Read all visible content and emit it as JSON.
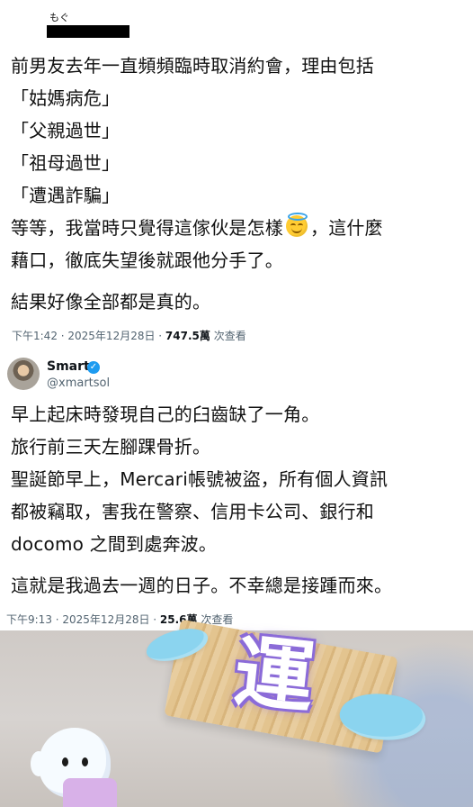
{
  "tweet1": {
    "author_name": "もぐ",
    "lines": [
      "前男友去年一直頻頻臨時取消約會，理由包括",
      "「姑媽病危」",
      "「父親過世」",
      "「祖母過世」",
      "「遭遇詐騙」",
      "等等，我當時只覺得這傢伙是怎樣",
      "，這什麼",
      "藉口，徹底失望後就跟他分手了。",
      "結果好像全部都是真的。"
    ],
    "timestamp": "下午1:42 · 2025年12月28日 · ",
    "views": "747.5萬",
    "views_suffix": " 次查看"
  },
  "tweet2": {
    "display_name": "Smart",
    "handle": "@xmartsol",
    "lines": [
      "早上起床時發現自己的臼齒缺了一角。",
      "旅行前三天左腳踝骨折。",
      "聖誕節早上，Mercari帳號被盜，所有個人資訊",
      "都被竊取，害我在警察、信用卡公司、銀行和",
      "docomo 之間到處奔波。",
      "這就是我過去一週的日子。不幸總是接踵而來。"
    ],
    "timestamp": "下午9:13 · 2025年12月28日 · ",
    "views": "25.6萬",
    "views_suffix": " 次查看"
  },
  "photo": {
    "block_text": "運"
  },
  "icons": {
    "emoji": "smiling-face-with-halo",
    "verified": "verified-badge-icon",
    "avatar": "profile-avatar"
  }
}
